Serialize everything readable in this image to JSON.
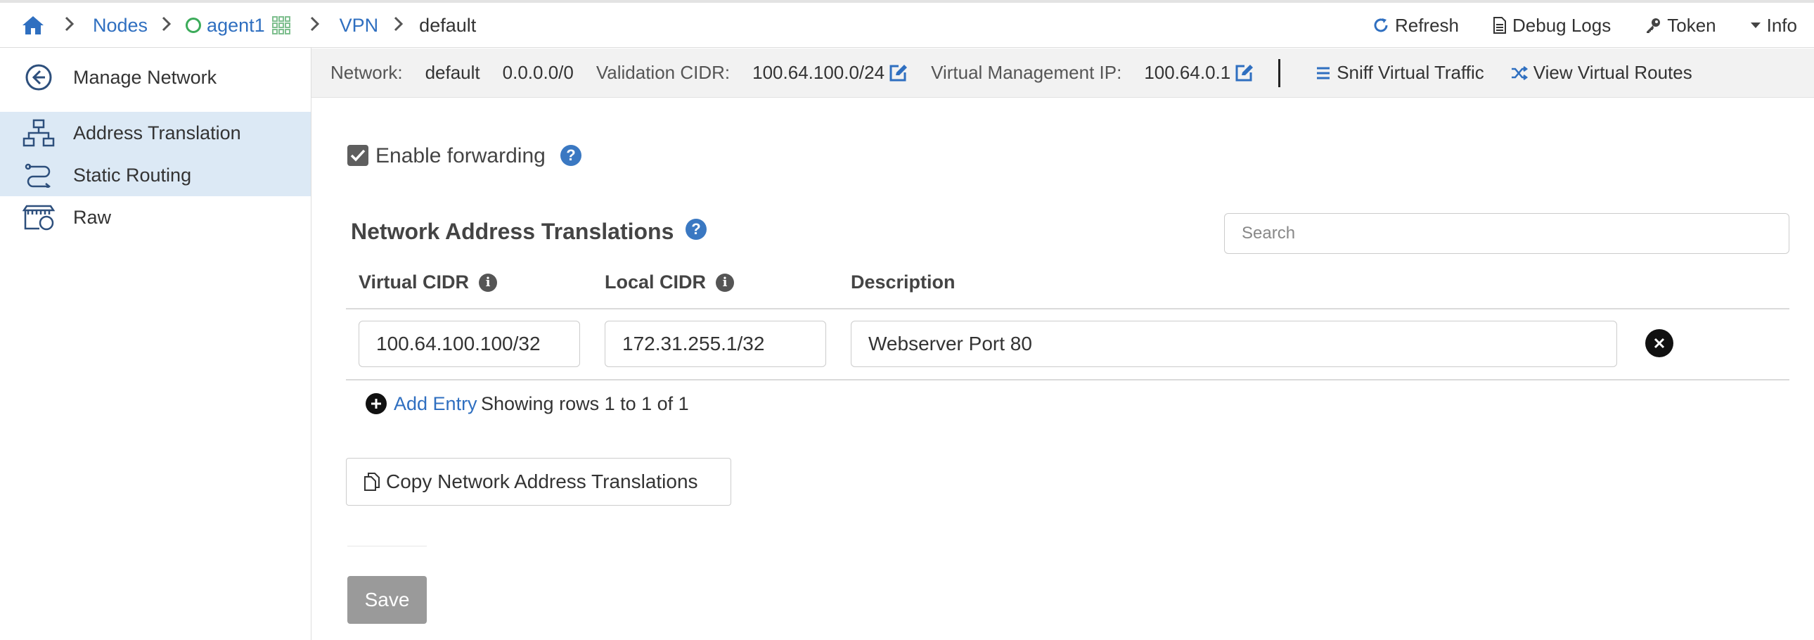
{
  "breadcrumb": {
    "nodes": "Nodes",
    "agent": "agent1",
    "vpn": "VPN",
    "current": "default"
  },
  "top_actions": {
    "refresh": "Refresh",
    "debug_logs": "Debug Logs",
    "token": "Token",
    "info": "Info"
  },
  "sidebar": {
    "items": [
      {
        "label": "Manage Network",
        "icon": "arrow-circle-left-icon"
      },
      {
        "label": "Address Translation",
        "icon": "sitemap-icon"
      },
      {
        "label": "Static Routing",
        "icon": "route-icon"
      },
      {
        "label": "Raw",
        "icon": "raw-icon"
      }
    ]
  },
  "infobar": {
    "network_label": "Network:",
    "network_value": "default",
    "network_cidr": "0.0.0.0/0",
    "validation_label": "Validation CIDR:",
    "validation_value": "100.64.100.0/24",
    "mgmt_label": "Virtual Management IP:",
    "mgmt_value": "100.64.0.1",
    "sniff": "Sniff Virtual Traffic",
    "routes": "View Virtual Routes"
  },
  "forwarding": {
    "label": "Enable forwarding",
    "checked": true
  },
  "nat": {
    "title": "Network Address Translations",
    "search_placeholder": "Search",
    "columns": {
      "virtual": "Virtual CIDR",
      "local": "Local CIDR",
      "description": "Description"
    },
    "rows": [
      {
        "virtual": "100.64.100.100/32",
        "local": "172.31.255.1/32",
        "description": "Webserver Port 80"
      }
    ],
    "add_entry": "Add Entry",
    "showing": "Showing rows 1 to 1 of 1",
    "copy_button": "Copy Network Address Translations",
    "save_button": "Save"
  },
  "colors": {
    "link": "#2f6fc0",
    "active_bg": "#dce9f5",
    "status_green": "#3cab5a",
    "save_bg": "#9a9a9a"
  }
}
